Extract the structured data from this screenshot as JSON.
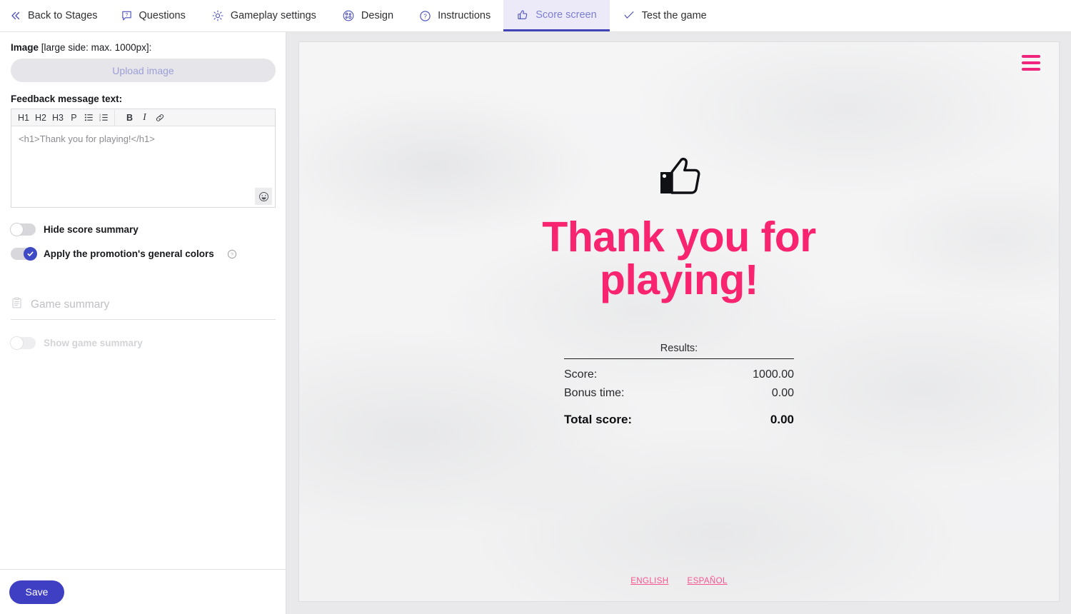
{
  "tabs": [
    {
      "label": "Back to Stages",
      "icon": "chevrons-left-icon",
      "active": false
    },
    {
      "label": "Questions",
      "icon": "question-bubble-icon",
      "active": false
    },
    {
      "label": "Gameplay settings",
      "icon": "gear-icon",
      "active": false
    },
    {
      "label": "Design",
      "icon": "palette-icon",
      "active": false
    },
    {
      "label": "Instructions",
      "icon": "question-circle-icon",
      "active": false
    },
    {
      "label": "Score screen",
      "icon": "thumbs-up-icon",
      "active": true
    },
    {
      "label": "Test the game",
      "icon": "check-badge-icon",
      "active": false
    }
  ],
  "sidebar": {
    "image_label_strong": "Image",
    "image_label_hint": "[large side: max. 1000px]:",
    "upload_button": "Upload image",
    "feedback_label": "Feedback message text:",
    "editor": {
      "toolbar": [
        "H1",
        "H2",
        "H3",
        "P",
        "bulleted-list",
        "numbered-list",
        "B",
        "I",
        "link"
      ],
      "content": "<h1>Thank you for playing!</h1>",
      "emoji_button": "emoji-picker"
    },
    "toggles": [
      {
        "label": "Hide score summary",
        "on": false,
        "disabled": false,
        "help": false
      },
      {
        "label": "Apply the promotion's general colors",
        "on": true,
        "disabled": false,
        "help": true
      },
      {
        "label": "Show game summary",
        "on": false,
        "disabled": true,
        "help": false
      }
    ],
    "game_summary_placeholder": "Game summary",
    "game_summary_value": "",
    "save_label": "Save"
  },
  "preview": {
    "menu_icon": "hamburger-menu-icon",
    "thumb_icon": "thumbs-up-icon",
    "headline": "Thank you for playing!",
    "results": {
      "title": "Results:",
      "rows": [
        {
          "label": "Score:",
          "value": "1000.00"
        },
        {
          "label": "Bonus time:",
          "value": "0.00"
        }
      ],
      "total": {
        "label": "Total score:",
        "value": "0.00"
      }
    },
    "languages": [
      "ENGLISH",
      "ESPAÑOL"
    ]
  },
  "colors": {
    "accent_pink": "#f8246f",
    "menu_pink": "#f0237d",
    "lang_pink": "#f8548f",
    "brand_blue": "#3f3fc4",
    "tab_active_bg": "#eceaf8",
    "tab_active_text": "#7b7fd4"
  }
}
